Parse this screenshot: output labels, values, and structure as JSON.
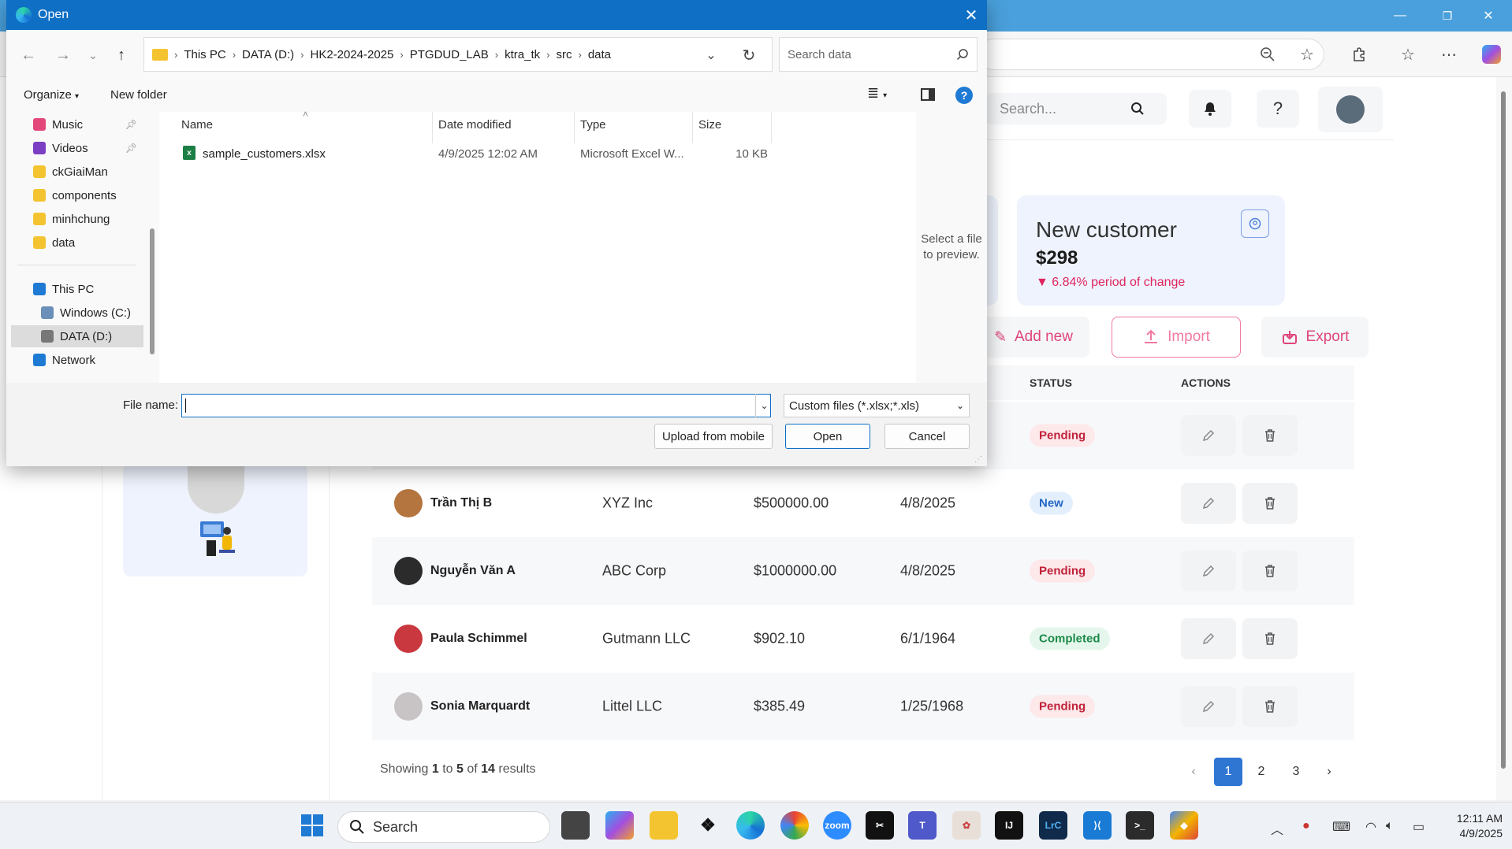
{
  "browser": {
    "window_controls": [
      "—",
      "❐",
      "✕"
    ],
    "toolbar_icons": [
      "zoom-out",
      "favorite",
      "extensions",
      "favorites",
      "more",
      "copilot"
    ]
  },
  "app": {
    "search_placeholder": "Search...",
    "card": {
      "title": "New customer",
      "value": "$298",
      "change": "▼ 6.84% period of change"
    },
    "actions": {
      "add_new": "Add new",
      "import": "Import",
      "export": "Export"
    },
    "table": {
      "headers": {
        "status": "STATUS",
        "actions": "ACTIONS"
      },
      "rows": [
        {
          "name": "",
          "company": "",
          "value": "",
          "date": "",
          "status": "Pending",
          "status_type": "pending"
        },
        {
          "name": "Trần Thị B",
          "company": "XYZ Inc",
          "value": "$500000.00",
          "date": "4/8/2025",
          "status": "New",
          "status_type": "new",
          "avatar_color": "#b5753e"
        },
        {
          "name": "Nguyễn Văn A",
          "company": "ABC Corp",
          "value": "$1000000.00",
          "date": "4/8/2025",
          "status": "Pending",
          "status_type": "pending",
          "avatar_color": "#2b2b2b"
        },
        {
          "name": "Paula Schimmel",
          "company": "Gutmann LLC",
          "value": "$902.10",
          "date": "6/1/1964",
          "status": "Completed",
          "status_type": "completed",
          "avatar_color": "#c9373f"
        },
        {
          "name": "Sonia Marquardt",
          "company": "Littel LLC",
          "value": "$385.49",
          "date": "1/25/1968",
          "status": "Pending",
          "status_type": "pending",
          "avatar_color": "#c8c3c4"
        }
      ]
    },
    "pagination": {
      "showing_prefix": "Showing",
      "from": "1",
      "to_word": "to",
      "to": "5",
      "of_word": "of",
      "total": "14",
      "results_word": "results",
      "pages": [
        "1",
        "2",
        "3"
      ],
      "active_page": "1"
    }
  },
  "dialog": {
    "title": "Open",
    "breadcrumb": [
      "This PC",
      "DATA (D:)",
      "HK2-2024-2025",
      "PTGDUD_LAB",
      "ktra_tk",
      "src",
      "data"
    ],
    "search_placeholder": "Search data",
    "organize": "Organize",
    "new_folder": "New folder",
    "nav_items": [
      {
        "label": "Music",
        "color": "#e2497a",
        "pinned": true
      },
      {
        "label": "Videos",
        "color": "#7b3fc4",
        "pinned": true
      },
      {
        "label": "ckGiaiMan",
        "color": "#f4c430"
      },
      {
        "label": "components",
        "color": "#f4c430"
      },
      {
        "label": "minhchung",
        "color": "#f4c430"
      },
      {
        "label": "data",
        "color": "#f4c430"
      }
    ],
    "nav_items_2": [
      {
        "label": "This PC",
        "color": "#1f7ad4"
      },
      {
        "label": "Windows (C:)",
        "color": "#6b8fb8"
      },
      {
        "label": "DATA (D:)",
        "color": "#777777",
        "selected": true
      },
      {
        "label": "Network",
        "color": "#1f7ad4"
      }
    ],
    "columns": {
      "name": "Name",
      "date": "Date modified",
      "type": "Type",
      "size": "Size"
    },
    "files": [
      {
        "name": "sample_customers.xlsx",
        "date": "4/9/2025 12:02 AM",
        "type": "Microsoft Excel W...",
        "size": "10 KB"
      }
    ],
    "preview_text_1": "Select a file",
    "preview_text_2": "to preview.",
    "file_name_label": "File name:",
    "file_name_value": "",
    "filter": "Custom files (*.xlsx;*.xls)",
    "upload_mobile": "Upload from mobile",
    "open": "Open",
    "cancel": "Cancel"
  },
  "taskbar": {
    "search": "Search",
    "time": "12:11 AM",
    "date": "4/9/2025"
  }
}
